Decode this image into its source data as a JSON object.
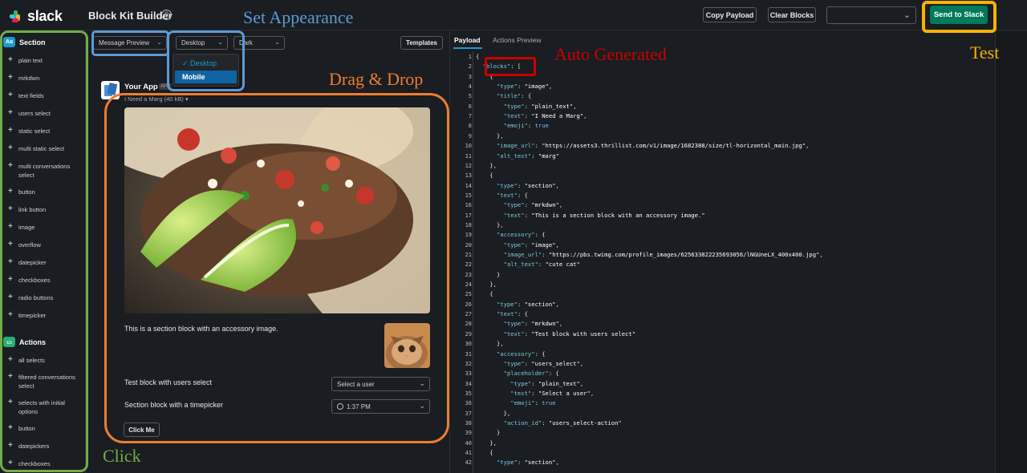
{
  "topbar": {
    "logo_text": "slack",
    "builder_title": "Block Kit Builder",
    "help_icon": "help-circle-icon",
    "copy_payload": "Copy Payload",
    "clear_blocks": "Clear Blocks",
    "workspace_select": "",
    "send": "Send to Slack"
  },
  "sidebar": {
    "section_header": "Section",
    "section_badge": "Aa",
    "section_items": [
      "plain text",
      "mrkdwn",
      "text fields",
      "users select",
      "static select",
      "multi static select",
      "multi conversations select",
      "button",
      "link button",
      "image",
      "overflow",
      "datepicker",
      "checkboxes",
      "radio buttons",
      "timepicker"
    ],
    "actions_header": "Actions",
    "actions_items": [
      "all selects",
      "filtered conversations select",
      "selects with initial options",
      "button",
      "datepickers",
      "checkboxes"
    ]
  },
  "preview": {
    "mode_select": "Message Preview",
    "device_select": "Desktop",
    "theme_select": "Dark",
    "templates": "Templates",
    "device_options": [
      {
        "label": "Desktop",
        "checked": true
      },
      {
        "label": "Mobile",
        "checked": false
      }
    ],
    "app_name": "Your App",
    "app_tag": "APP",
    "image_caption": "I Need a Marg (40 kB) ▾",
    "section_text": "This is a section block with an accessory image.",
    "users_label": "Test block with users select",
    "users_placeholder": "Select a user",
    "timepicker_label": "Section block with a timepicker",
    "timepicker_value": "1:37 PM",
    "button": "Click Me"
  },
  "payload": {
    "tab_payload": "Payload",
    "tab_actions": "Actions Preview",
    "lines": [
      "{",
      "  \"blocks\": [",
      "    {",
      "      \"type\": \"image\",",
      "      \"title\": {",
      "        \"type\": \"plain_text\",",
      "        \"text\": \"I Need a Marg\",",
      "        \"emoji\": true",
      "      },",
      "      \"image_url\": \"https://assets3.thrillist.com/v1/image/1682388/size/tl-horizontal_main.jpg\",",
      "      \"alt_text\": \"marg\"",
      "    },",
      "    {",
      "      \"type\": \"section\",",
      "      \"text\": {",
      "        \"type\": \"mrkdwn\",",
      "        \"text\": \"This is a section block with an accessory image.\"",
      "      },",
      "      \"accessory\": {",
      "        \"type\": \"image\",",
      "        \"image_url\": \"https://pbs.twimg.com/profile_images/625633822235693056/lNGUneLX_400x400.jpg\",",
      "        \"alt_text\": \"cute cat\"",
      "      }",
      "    },",
      "    {",
      "      \"type\": \"section\",",
      "      \"text\": {",
      "        \"type\": \"mrkdwn\",",
      "        \"text\": \"Test block with users select\"",
      "      },",
      "      \"accessory\": {",
      "        \"type\": \"users_select\",",
      "        \"placeholder\": {",
      "          \"type\": \"plain_text\",",
      "          \"text\": \"Select a user\",",
      "          \"emoji\": true",
      "        },",
      "        \"action_id\": \"users_select-action\"",
      "      }",
      "    },",
      "    {",
      "      \"type\": \"section\","
    ]
  },
  "annotations": {
    "set_appearance": "Set Appearance",
    "auto_generated": "Auto Generated",
    "drag_drop": "Drag & Drop",
    "test": "Test",
    "click": "Click"
  },
  "colors": {
    "appearance": "#5b9bd5",
    "auto_generated": "#cc0000",
    "drag_drop": "#ed7d31",
    "test": "#f5b300",
    "click": "#70ad47",
    "send_button": "#007a5a",
    "accent": "#1d9bd1"
  }
}
